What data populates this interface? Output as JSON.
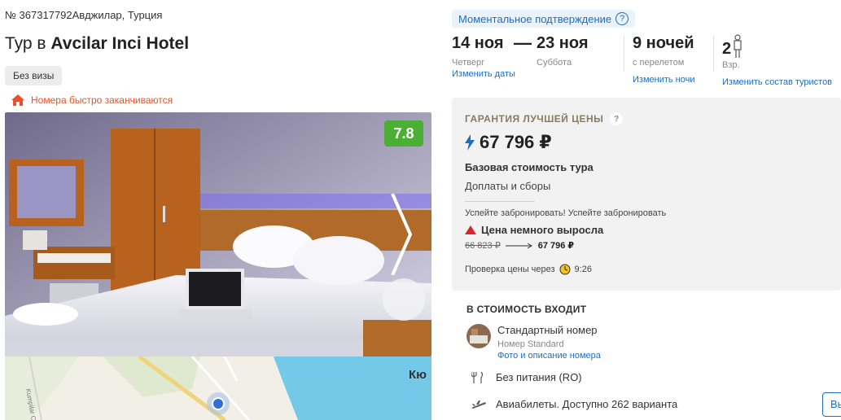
{
  "tour": {
    "id_text": "№ 367317792",
    "location": "Авджилар, Турция",
    "title_prefix": "Тур в ",
    "hotel_name": "Avcilar Inci Hotel",
    "visa_label": "Без визы",
    "hurry_text": "Номера быстро заканчиваются"
  },
  "gallery": {
    "rating": "7.8"
  },
  "map": {
    "place_label": "Кю",
    "street_label": "Kumpilar Cadde"
  },
  "booking": {
    "instant_label": "Моментальное подтверждение",
    "date_from": "14 ноя",
    "date_from_day": "Четверг",
    "date_to": "23 ноя",
    "date_to_day": "Суббота",
    "change_dates": "Изменить даты",
    "nights": "9 ночей",
    "nights_sub": "с перелетом",
    "change_nights": "Изменить ночи",
    "tourists": "2",
    "tourists_sub": "Взр.",
    "change_tourists": "Изменить состав туристов"
  },
  "price": {
    "guarantee": "ГАРАНТИЯ ЛУЧШЕЙ ЦЕНЫ",
    "value": "67 796 ₽",
    "base_cost": "Базовая стоимость тура",
    "extras": "Доплаты и сборы",
    "hurry_book": "Успейте забронировать! Успейте забронировать",
    "price_up": "Цена немного выросла",
    "old_price": "66 823 ₽",
    "new_price": "67 796 ₽",
    "check_label": "Проверка цены через",
    "check_time": "9:26"
  },
  "included": {
    "title": "В СТОИМОСТЬ ВХОДИТ",
    "room_name": "Стандартный номер",
    "room_sub": "Номер Standard",
    "room_link": "Фото и описание номера",
    "meal": "Без питания (RO)",
    "flight": "Авиабилеты. Доступно 262 варианта",
    "choose_button": "Вы"
  },
  "colors": {
    "accent": "#1f6cbf",
    "rating_bg": "#4caf33",
    "hurry": "#e8512e"
  }
}
